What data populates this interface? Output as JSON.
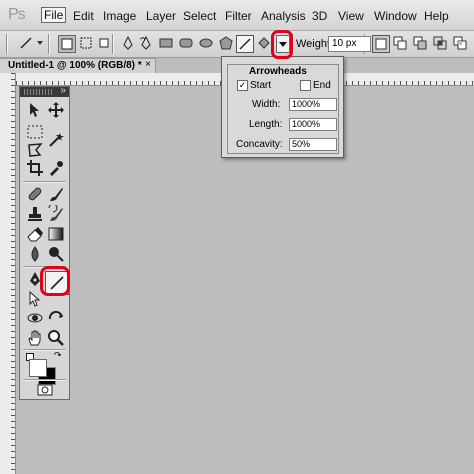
{
  "app": {
    "logo": "Ps"
  },
  "menu": [
    "File",
    "Edit",
    "Image",
    "Layer",
    "Select",
    "Filter",
    "Analysis",
    "3D",
    "View",
    "Window",
    "Help"
  ],
  "options_bar": {
    "weight_label": "Weight:",
    "weight_value": "10 px"
  },
  "document_tab": {
    "title": "Untitled-1 @ 100% (RGB/8) *",
    "close": "×"
  },
  "arrowheads": {
    "legend": "Arrowheads",
    "start_label": "Start",
    "start_checked": "✓",
    "end_label": "End",
    "width_label": "Width:",
    "width_value": "1000%",
    "length_label": "Length:",
    "length_value": "1000%",
    "concavity_label": "Concavity:",
    "concavity_value": "50%"
  },
  "toolbox": {
    "collapse": "»"
  },
  "colors": {
    "highlight": "#e2001a"
  }
}
